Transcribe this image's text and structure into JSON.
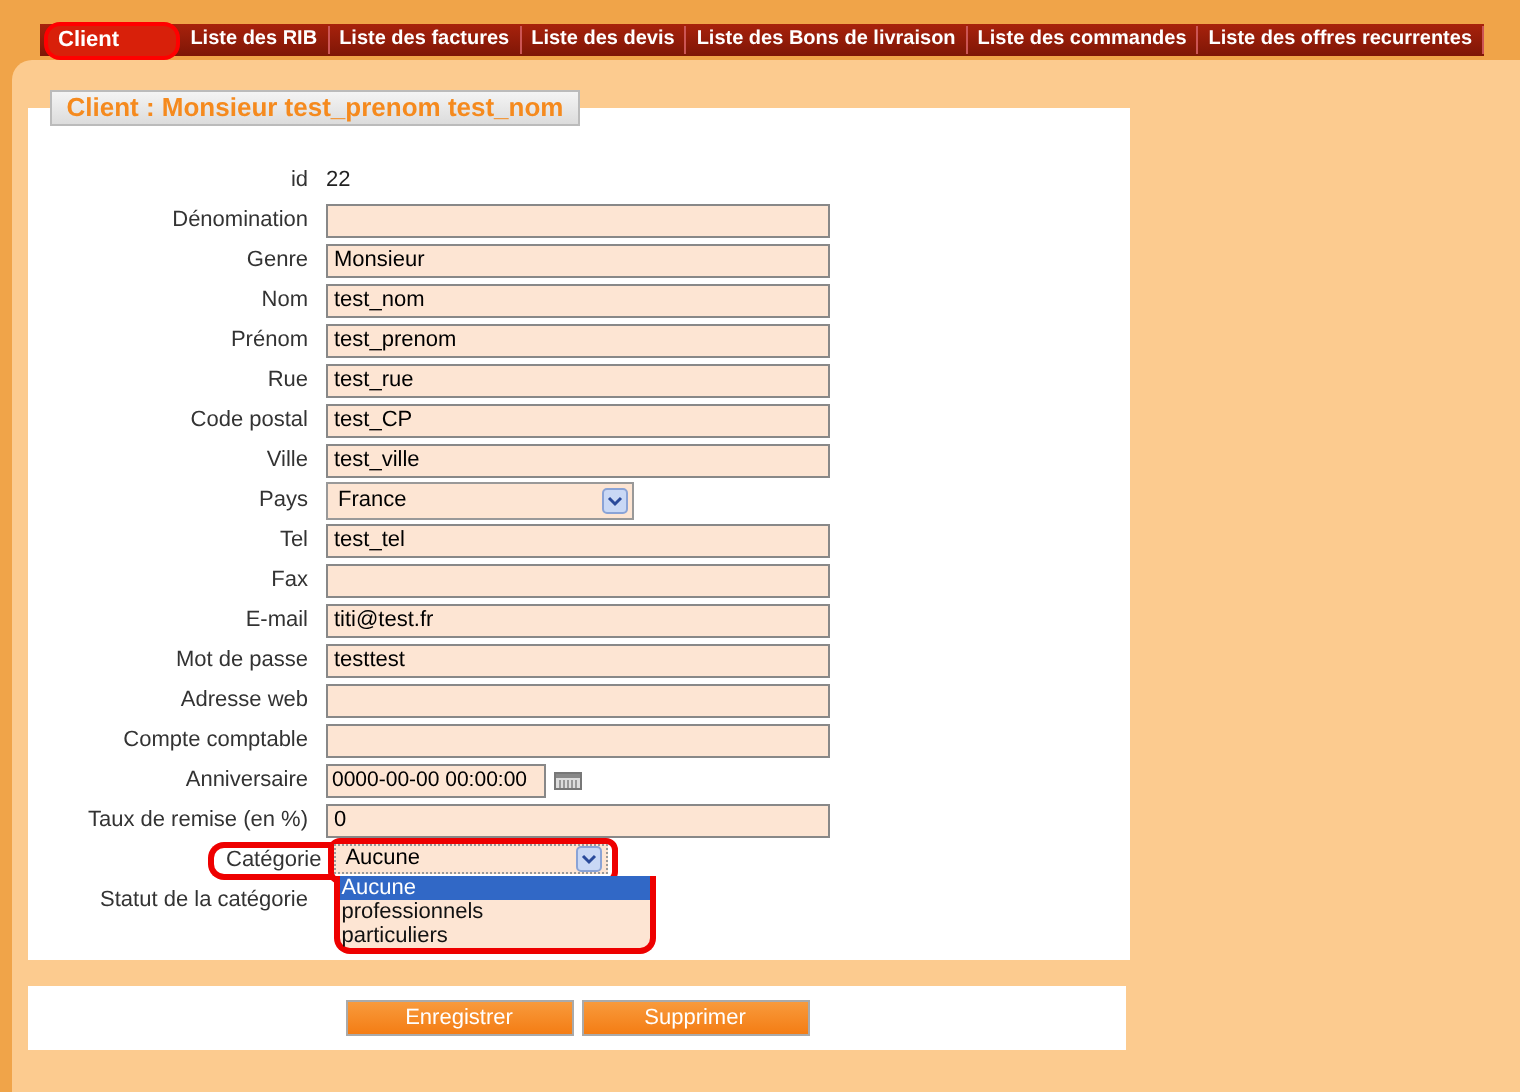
{
  "tabs": [
    {
      "label": "Client",
      "selected": true,
      "highlighted": true
    },
    {
      "label": "Liste des RIB",
      "selected": false,
      "highlighted": false
    },
    {
      "label": "Liste des factures",
      "selected": false,
      "highlighted": false
    },
    {
      "label": "Liste des devis",
      "selected": false,
      "highlighted": false
    },
    {
      "label": "Liste des Bons de livraison",
      "selected": false,
      "highlighted": false
    },
    {
      "label": "Liste des commandes",
      "selected": false,
      "highlighted": false
    },
    {
      "label": "Liste des offres recurrentes",
      "selected": false,
      "highlighted": false
    }
  ],
  "panel_title": "Client : Monsieur test_prenom test_nom",
  "fields": [
    {
      "kind": "plain",
      "label": "id",
      "value": "22"
    },
    {
      "kind": "text",
      "label": "Dénomination"
    },
    {
      "kind": "text",
      "label": "Genre",
      "value": "Monsieur"
    },
    {
      "kind": "text",
      "label": "Nom",
      "value": "test_nom"
    },
    {
      "kind": "text",
      "label": "Prénom",
      "value": "test_prenom"
    },
    {
      "kind": "text",
      "label": "Rue",
      "value": "test_rue"
    },
    {
      "kind": "text",
      "label": "Code postal",
      "value": "test_CP"
    },
    {
      "kind": "text",
      "label": "Ville",
      "value": "test_ville"
    },
    {
      "kind": "select",
      "label": "Pays",
      "value": "France"
    },
    {
      "kind": "text",
      "label": "Tel",
      "value": "test_tel"
    },
    {
      "kind": "text",
      "label": "Fax"
    },
    {
      "kind": "text",
      "label": "E-mail",
      "value": "titi@test.fr"
    },
    {
      "kind": "text",
      "label": "Mot de passe",
      "value": "testtest"
    },
    {
      "kind": "text",
      "label": "Adresse web"
    },
    {
      "kind": "text",
      "label": "Compte comptable"
    },
    {
      "kind": "date",
      "label": "Anniversaire",
      "value": "0000-00-00 00:00:00"
    },
    {
      "kind": "text",
      "label": "Taux de remise (en %)",
      "value": "0"
    },
    {
      "kind": "dropdown",
      "label": "Catégorie",
      "value": "Aucune",
      "highlighted": true,
      "expanded": true,
      "options": [
        {
          "label": "Aucune",
          "selected": true
        },
        {
          "label": "professionnels",
          "selected": false
        },
        {
          "label": "particuliers",
          "selected": false
        }
      ]
    },
    {
      "kind": "label",
      "label": "Statut de la catégorie"
    }
  ],
  "buttons": [
    "Enregistrer",
    "Supprimer"
  ]
}
